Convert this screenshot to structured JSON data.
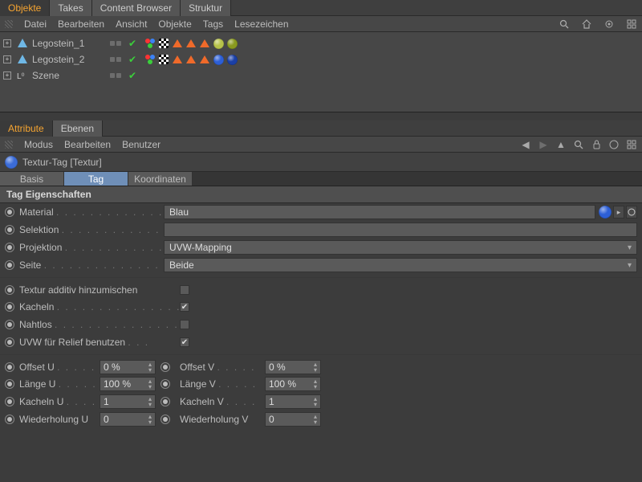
{
  "topTabs": {
    "objekte": "Objekte",
    "takes": "Takes",
    "content": "Content Browser",
    "struktur": "Struktur"
  },
  "menu1": {
    "datei": "Datei",
    "bearbeiten": "Bearbeiten",
    "ansicht": "Ansicht",
    "objekte": "Objekte",
    "tags": "Tags",
    "lesezeichen": "Lesezeichen"
  },
  "tree": {
    "items": [
      {
        "name": "Legostein_1",
        "mat": "#b7c24a"
      },
      {
        "name": "Legostein_2",
        "mat": "#2d5fd6"
      },
      {
        "name": "Szene"
      }
    ]
  },
  "attrTabs": {
    "attribute": "Attribute",
    "ebenen": "Ebenen"
  },
  "menu2": {
    "modus": "Modus",
    "bearbeiten": "Bearbeiten",
    "benutzer": "Benutzer"
  },
  "title": "Textur-Tag [Textur]",
  "subTabs": {
    "basis": "Basis",
    "tag": "Tag",
    "koord": "Koordinaten"
  },
  "section": "Tag Eigenschaften",
  "props": {
    "material": {
      "label": "Material",
      "value": "Blau"
    },
    "selektion": {
      "label": "Selektion",
      "value": ""
    },
    "projektion": {
      "label": "Projektion",
      "value": "UVW-Mapping"
    },
    "seite": {
      "label": "Seite",
      "value": "Beide"
    },
    "texturAdditiv": {
      "label": "Textur additiv hinzumischen",
      "checked": false
    },
    "kacheln": {
      "label": "Kacheln",
      "checked": true
    },
    "nahtlos": {
      "label": "Nahtlos",
      "checked": false
    },
    "uvwRelief": {
      "label": "UVW für Relief benutzen",
      "checked": true
    },
    "offsetU": {
      "label": "Offset U",
      "value": "0 %"
    },
    "offsetV": {
      "label": "Offset V",
      "value": "0 %"
    },
    "laengeU": {
      "label": "Länge U",
      "value": "100 %"
    },
    "laengeV": {
      "label": "Länge V",
      "value": "100 %"
    },
    "kachelnU": {
      "label": "Kacheln U",
      "value": "1"
    },
    "kachelnV": {
      "label": "Kacheln V",
      "value": "1"
    },
    "wdhU": {
      "label": "Wiederholung U",
      "value": "0"
    },
    "wdhV": {
      "label": "Wiederholung V",
      "value": "0"
    }
  }
}
